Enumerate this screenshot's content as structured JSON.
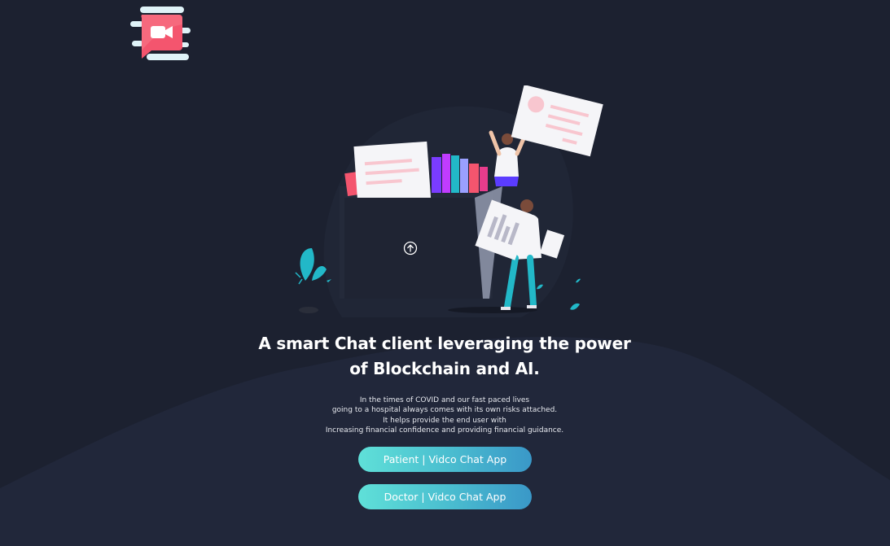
{
  "app": {
    "logo_icon": "video-chat-logo-icon"
  },
  "hero": {
    "illustration_icon": "team-files-illustration",
    "upload_icon": "upload-arrow-icon",
    "headline_line1": "A smart Chat client leveraging the power",
    "headline_line2": "of Blockchain and AI.",
    "description_lines": [
      "In the times of COVID and our fast paced lives",
      "going to a hospital always comes with its own risks attached.",
      "It helps provide the end user with",
      "Increasing financial confidence and providing financial guidance."
    ]
  },
  "actions": {
    "patient_label": "Patient | Vidco Chat App",
    "doctor_label": "Doctor | Vidco Chat App"
  },
  "colors": {
    "background": "#1c2130",
    "wave": "#232838",
    "button_gradient_start": "#5fe0d8",
    "button_gradient_end": "#3a98c8",
    "logo_pink": "#f4556e",
    "accent_teal": "#22b8c8"
  }
}
